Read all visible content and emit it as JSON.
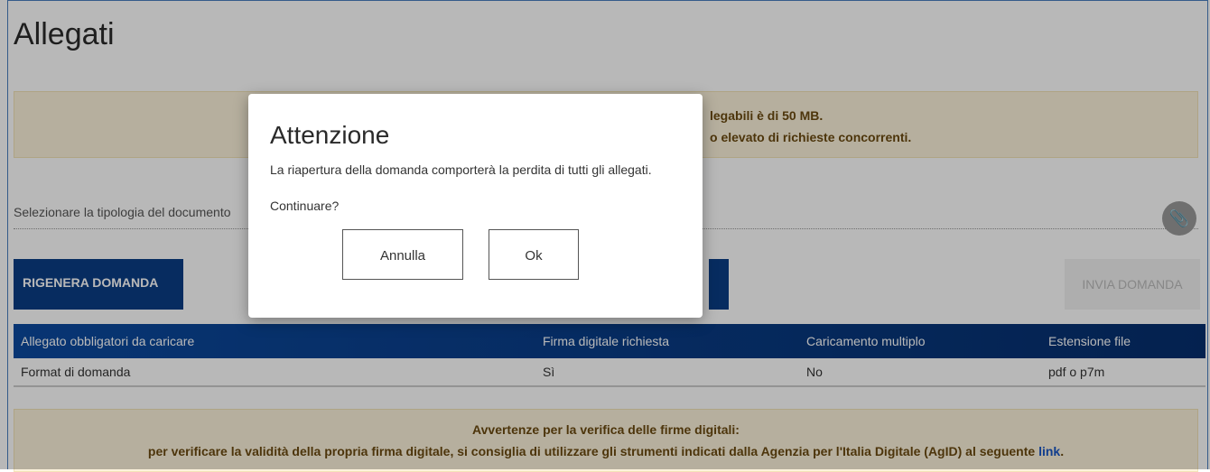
{
  "page": {
    "title": "Allegati",
    "notice_top": {
      "line1": "legabili è di 50 MB.",
      "line2": "o elevato di richieste concorrenti."
    },
    "select": {
      "label": "Selezionare la tipologia del documento"
    },
    "buttons": {
      "rigenera": "RIGENERA DOMANDA",
      "invia": "INVIA DOMANDA"
    },
    "table": {
      "headers": [
        "Allegato obbligatori da caricare",
        "Firma digitale richiesta",
        "Caricamento multiplo",
        "Estensione file"
      ],
      "rows": [
        [
          "Format di domanda",
          "Sì",
          "No",
          "pdf o p7m"
        ]
      ]
    },
    "notice_bottom": {
      "line1": "Avvertenze per la verifica delle firme digitali:",
      "line2": "per verificare la validità della propria firma digitale, si consiglia di utilizzare gli strumenti indicati dalla Agenzia per l'Italia Digitale (AgID) al seguente",
      "link": "link",
      "end": "."
    }
  },
  "modal": {
    "title": "Attenzione",
    "message": "La riapertura della domanda comporterà la perdita di tutti gli allegati.",
    "question": "Continuare?",
    "cancel": "Annulla",
    "ok": "Ok"
  },
  "colors": {
    "primary": "#0a3d86",
    "notice_bg": "#fcf3dc",
    "notice_text": "#6b4a10"
  }
}
